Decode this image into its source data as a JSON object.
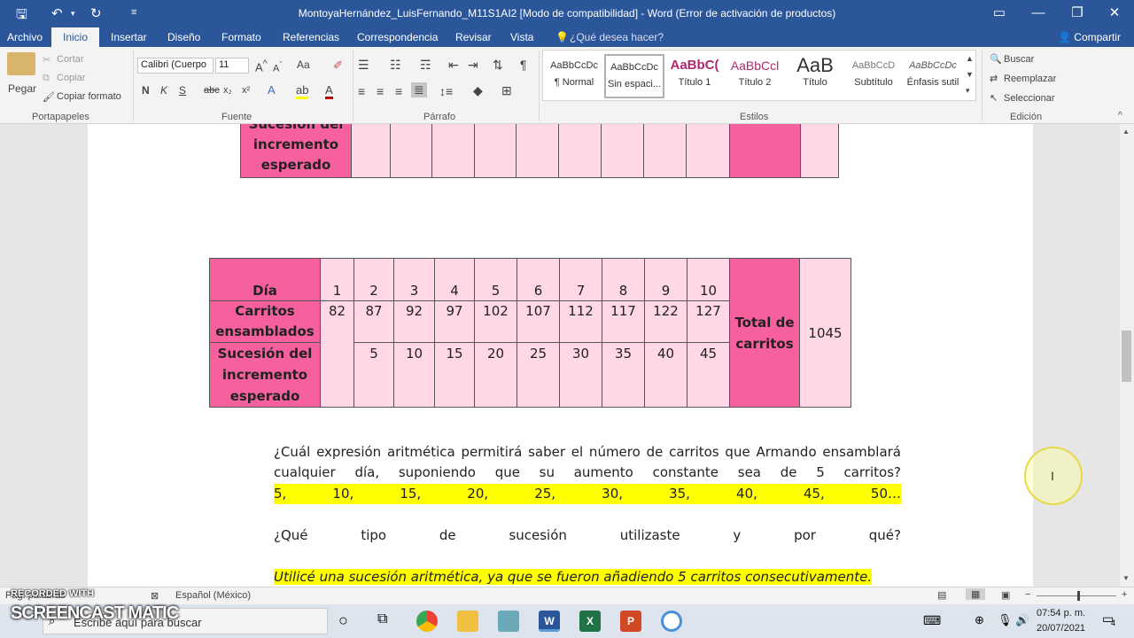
{
  "window": {
    "title": "MontoyaHernández_LuisFernando_M11S1AI2 [Modo de compatibilidad] - Word (Error de activación de productos)",
    "share_label": "Compartir"
  },
  "tabs": [
    "Archivo",
    "Inicio",
    "Insertar",
    "Diseño",
    "Formato",
    "Referencias",
    "Correspondencia",
    "Revisar",
    "Vista"
  ],
  "tell_me_placeholder": "¿Qué desea hacer?",
  "ribbon": {
    "clipboard": {
      "paste": "Pegar",
      "cut": "Cortar",
      "copy": "Copiar",
      "format_painter": "Copiar formato",
      "label": "Portapapeles"
    },
    "font": {
      "name": "Calibri (Cuerpo",
      "size": "11",
      "label": "Fuente",
      "case": "Aa"
    },
    "paragraph": {
      "label": "Párrafo"
    },
    "styles": {
      "label": "Estilos",
      "items": [
        {
          "sample": "AaBbCcDc",
          "name": "¶ Normal"
        },
        {
          "sample": "AaBbCcDc",
          "name": "Sin espaci..."
        },
        {
          "sample": "AaBbC(",
          "name": "Título 1"
        },
        {
          "sample": "AaBbCcl",
          "name": "Título 2"
        },
        {
          "sample": "AaB",
          "name": "Título"
        },
        {
          "sample": "AaBbCcD",
          "name": "Subtítulo"
        },
        {
          "sample": "AaBbCcDc",
          "name": "Énfasis sutil"
        }
      ]
    },
    "editing": {
      "find": "Buscar",
      "replace": "Reemplazar",
      "select": "Seleccionar",
      "label": "Edición"
    }
  },
  "top_table": {
    "label": "Sucesión del incremento esperado"
  },
  "table": {
    "row1_label": "Día",
    "days": [
      "1",
      "2",
      "3",
      "4",
      "5",
      "6",
      "7",
      "8",
      "9",
      "10"
    ],
    "row2_label": "Carritos ensamblados",
    "cars": [
      "82",
      "87",
      "92",
      "97",
      "102",
      "107",
      "112",
      "117",
      "122",
      "127"
    ],
    "row3_label": "Sucesión del incremento esperado",
    "increments": [
      "5",
      "10",
      "15",
      "20",
      "25",
      "30",
      "35",
      "40",
      "45"
    ],
    "total_label": "Total de carritos",
    "total_value": "1045"
  },
  "body": {
    "question1": "¿Cuál expresión aritmética permitirá saber el número de carritos que Armando ensamblará cualquier día, suponiendo que su aumento constante sea de 5 carritos?",
    "sequence": "5, 10, 15, 20, 25, 30, 35, 40, 45, 50…",
    "question2": "¿Qué tipo de sucesión utilizaste y por qué?",
    "answer2": "Utilicé una sucesión aritmética, ya que se fueron añadiendo 5 carritos consecutivamente."
  },
  "statusbar": {
    "words": "Pág. palabras",
    "language": "Español (México)"
  },
  "overlay": {
    "recorded": "RECORDED WITH",
    "brand": "SCREENCAST MATIC"
  },
  "taskbar": {
    "search_placeholder": "Escribe aquí para buscar",
    "time": "07:54 p. m.",
    "date": "20/07/2021",
    "notifications": "4"
  },
  "colors": {
    "ribbon_blue": "#2b579a",
    "table_pink": "#ffd7e6",
    "table_dark_pink": "#f7609e",
    "highlight": "#ffff00"
  }
}
